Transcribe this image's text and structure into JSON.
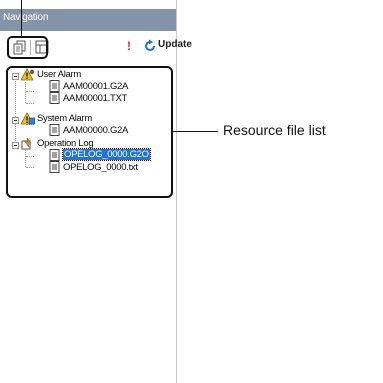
{
  "panel": {
    "title": "Navigation",
    "toolbar": {
      "update_label": "Update",
      "warning_mark": "!"
    }
  },
  "tree": {
    "groups": [
      {
        "label": "User Alarm",
        "files": [
          "AAM00001.G2A",
          "AAM00001.TXT"
        ]
      },
      {
        "label": "System Alarm",
        "files": [
          "AAM00000.G2A"
        ]
      },
      {
        "label": "Operation Log",
        "files": [
          "OPELOG_0000.G2O",
          "OPELOG_0000.txt"
        ]
      }
    ],
    "selected_file": "OPELOG_0000.G2O"
  },
  "callout": {
    "label": "Resource file list"
  },
  "colors": {
    "title_bar": "#8593a8",
    "selection": "#1e74d9",
    "warning": "#e8232a"
  }
}
